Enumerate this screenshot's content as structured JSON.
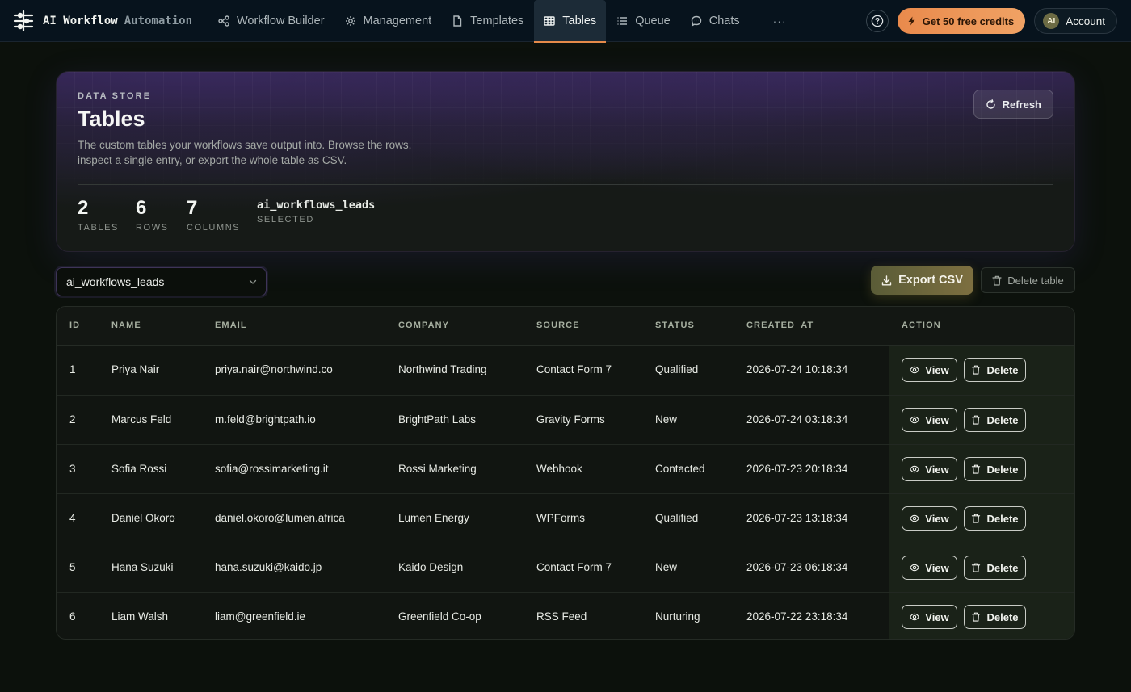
{
  "app": {
    "name": "AI Workflow",
    "sub": "Automation"
  },
  "nav": [
    {
      "label": "Workflow Builder",
      "icon": "flow-icon",
      "active": false
    },
    {
      "label": "Management",
      "icon": "gear-icon",
      "active": false
    },
    {
      "label": "Templates",
      "icon": "document-icon",
      "active": false
    },
    {
      "label": "Tables",
      "icon": "table-icon",
      "active": true
    },
    {
      "label": "Queue",
      "icon": "list-icon",
      "active": false
    },
    {
      "label": "Chats",
      "icon": "chat-icon",
      "active": false
    }
  ],
  "nav_more": "···",
  "topright": {
    "credits_label": "Get 50 free credits",
    "account_initials": "AI",
    "account_label": "Account"
  },
  "hero": {
    "eyebrow": "DATA STORE",
    "title": "Tables",
    "description": "The custom tables your workflows save output into. Browse the rows, inspect a single entry, or export the whole table as CSV.",
    "refresh_label": "Refresh",
    "stats": [
      {
        "value": "2",
        "label": "TABLES"
      },
      {
        "value": "6",
        "label": "ROWS"
      },
      {
        "value": "7",
        "label": "COLUMNS"
      }
    ],
    "selected": {
      "value": "ai_workflows_leads",
      "label": "SELECTED"
    }
  },
  "controls": {
    "selected_table": "ai_workflows_leads",
    "export_label": "Export CSV",
    "delete_table_label": "Delete table"
  },
  "table": {
    "columns": [
      "ID",
      "NAME",
      "EMAIL",
      "COMPANY",
      "SOURCE",
      "STATUS",
      "CREATED_AT",
      "ACTION"
    ],
    "view_label": "View",
    "delete_label": "Delete",
    "rows": [
      {
        "id": "1",
        "name": "Priya Nair",
        "email": "priya.nair@northwind.co",
        "company": "Northwind Trading",
        "source": "Contact Form 7",
        "status": "Qualified",
        "created_at": "2026-07-24 10:18:34"
      },
      {
        "id": "2",
        "name": "Marcus Feld",
        "email": "m.feld@brightpath.io",
        "company": "BrightPath Labs",
        "source": "Gravity Forms",
        "status": "New",
        "created_at": "2026-07-24 03:18:34"
      },
      {
        "id": "3",
        "name": "Sofia Rossi",
        "email": "sofia@rossimarketing.it",
        "company": "Rossi Marketing",
        "source": "Webhook",
        "status": "Contacted",
        "created_at": "2026-07-23 20:18:34"
      },
      {
        "id": "4",
        "name": "Daniel Okoro",
        "email": "daniel.okoro@lumen.africa",
        "company": "Lumen Energy",
        "source": "WPForms",
        "status": "Qualified",
        "created_at": "2026-07-23 13:18:34"
      },
      {
        "id": "5",
        "name": "Hana Suzuki",
        "email": "hana.suzuki@kaido.jp",
        "company": "Kaido Design",
        "source": "Contact Form 7",
        "status": "New",
        "created_at": "2026-07-23 06:18:34"
      },
      {
        "id": "6",
        "name": "Liam Walsh",
        "email": "liam@greenfield.ie",
        "company": "Greenfield Co-op",
        "source": "RSS Feed",
        "status": "Nurturing",
        "created_at": "2026-07-22 23:18:34"
      }
    ]
  }
}
